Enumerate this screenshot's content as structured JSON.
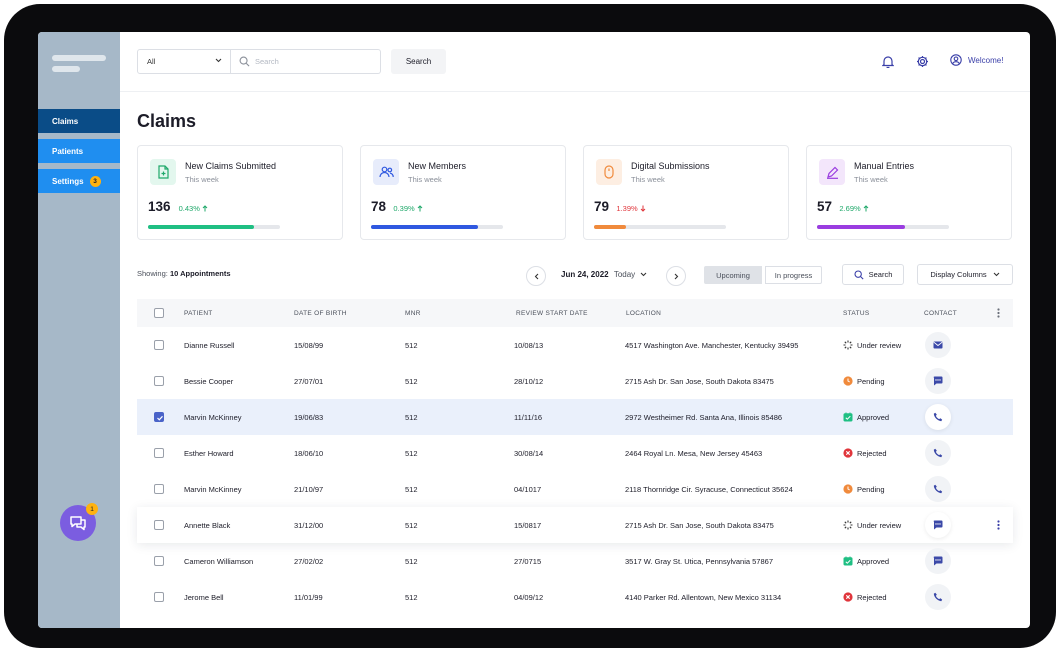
{
  "sidebar": {
    "items": [
      {
        "label": "Claims",
        "active": true
      },
      {
        "label": "Patients",
        "active": false
      },
      {
        "label": "Settings",
        "active": false,
        "badge": "3"
      }
    ],
    "chat_badge": "1"
  },
  "topbar": {
    "filter_value": "All",
    "search_placeholder": "Search",
    "search_button": "Search",
    "welcome": "Welcome!"
  },
  "page": {
    "title": "Claims"
  },
  "cards": [
    {
      "title": "New Claims Submitted",
      "sub": "This week",
      "value": "136",
      "change": "0.43%",
      "direction": "up",
      "progress": 0.8,
      "color": "#1fbf83",
      "icon_bg": "#e3f7ee",
      "icon": "file-plus-icon"
    },
    {
      "title": "New Members",
      "sub": "This week",
      "value": "78",
      "change": "0.39%",
      "direction": "up",
      "progress": 0.81,
      "color": "#2f58e0",
      "icon_bg": "#e7ecfb",
      "icon": "users-icon"
    },
    {
      "title": "Digital Submissions",
      "sub": "This week",
      "value": "79",
      "change": "1.39%",
      "direction": "down",
      "progress": 0.24,
      "color": "#f08a3c",
      "icon_bg": "#fdeee2",
      "icon": "mouse-icon"
    },
    {
      "title": "Manual Entries",
      "sub": "This week",
      "value": "57",
      "change": "2.69%",
      "direction": "up",
      "progress": 0.67,
      "color": "#9a3de0",
      "icon_bg": "#f3e6fb",
      "icon": "pen-icon"
    }
  ],
  "toolbar": {
    "showing_label": "Showing:",
    "showing_value": "10 Appointments",
    "date": "Jun 24, 2022",
    "today": "Today",
    "segments": [
      {
        "label": "Upcoming",
        "active": true
      },
      {
        "label": "In progress",
        "active": false
      }
    ],
    "search_label": "Search",
    "display_columns": "Display Columns"
  },
  "table": {
    "headers": [
      "PATIENT",
      "DATE OF BIRTH",
      "MNR",
      "REVIEW START DATE",
      "LOCATION",
      "STATUS",
      "CONTACT"
    ],
    "rows": [
      {
        "patient": "Dianne Russell",
        "dob": "15/08/99",
        "mnr": "512",
        "review": "10/08/13",
        "location": "4517 Washington Ave. Manchester, Kentucky 39495",
        "status": "Under review",
        "contact": "mail-icon",
        "checked": false,
        "state": ""
      },
      {
        "patient": "Bessie Cooper",
        "dob": "27/07/01",
        "mnr": "512",
        "review": "28/10/12",
        "location": "2715 Ash Dr. San Jose, South Dakota 83475",
        "status": "Pending",
        "contact": "chat-icon",
        "checked": false,
        "state": ""
      },
      {
        "patient": "Marvin McKinney",
        "dob": "19/06/83",
        "mnr": "512",
        "review": "11/11/16",
        "location": "2972 Westheimer Rd. Santa Ana, Illinois 85486",
        "status": "Approved",
        "contact": "phone-icon",
        "checked": true,
        "state": "selected"
      },
      {
        "patient": "Esther Howard",
        "dob": "18/06/10",
        "mnr": "512",
        "review": "30/08/14",
        "location": "2464 Royal Ln. Mesa, New Jersey 45463",
        "status": "Rejected",
        "contact": "phone-icon",
        "checked": false,
        "state": ""
      },
      {
        "patient": "Marvin McKinney",
        "dob": "21/10/97",
        "mnr": "512",
        "review": "04/1017",
        "location": "2118 Thornridge Cir. Syracuse, Connecticut 35624",
        "status": "Pending",
        "contact": "phone-icon",
        "checked": false,
        "state": ""
      },
      {
        "patient": "Annette Black",
        "dob": "31/12/00",
        "mnr": "512",
        "review": "15/0817",
        "location": "2715 Ash Dr. San Jose, South Dakota 83475",
        "status": "Under review",
        "contact": "chat-icon",
        "checked": false,
        "state": "hover"
      },
      {
        "patient": "Cameron Williamson",
        "dob": "27/02/02",
        "mnr": "512",
        "review": "27/0715",
        "location": "3517 W. Gray St. Utica, Pennsylvania 57867",
        "status": "Approved",
        "contact": "chat-icon",
        "checked": false,
        "state": ""
      },
      {
        "patient": "Jerome Bell",
        "dob": "11/01/99",
        "mnr": "512",
        "review": "04/09/12",
        "location": "4140 Parker Rd. Allentown, New Mexico 31134",
        "status": "Rejected",
        "contact": "phone-icon",
        "checked": false,
        "state": ""
      }
    ]
  },
  "colors": {
    "pending": "#f08a3c",
    "approved": "#1fbf83",
    "rejected": "#e0353b",
    "contact_icon": "#3b49a8",
    "up": "#1fa86a",
    "down": "#e0353b"
  }
}
